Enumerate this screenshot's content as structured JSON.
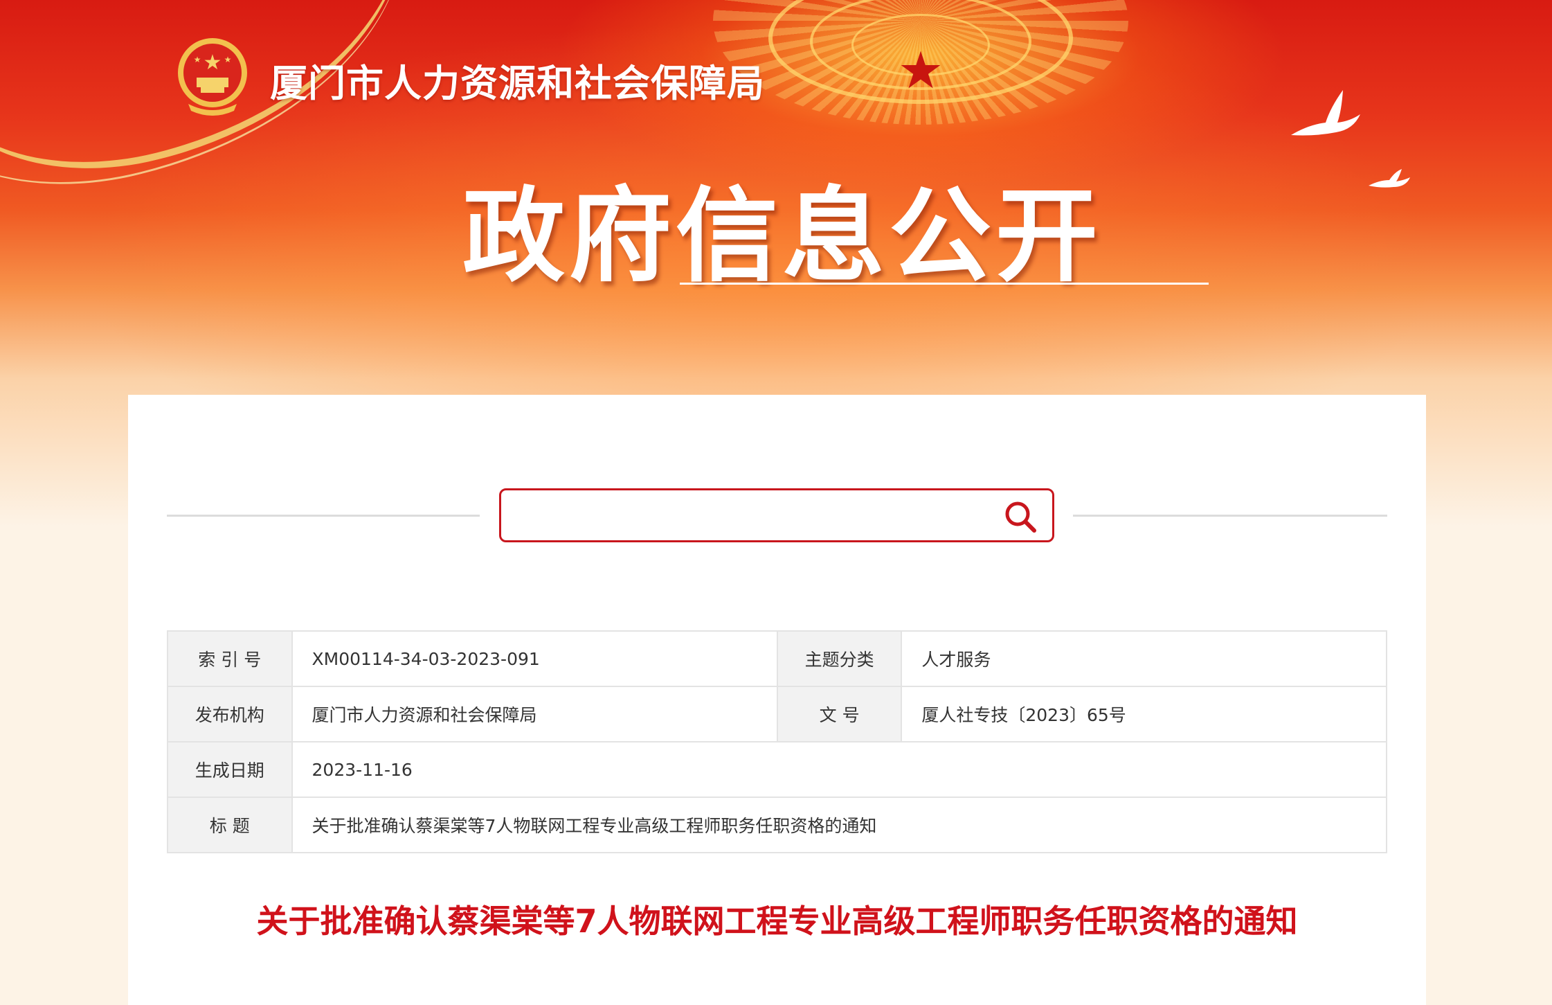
{
  "header": {
    "org_name": "厦门市人力资源和社会保障局",
    "main_title": "政府信息公开"
  },
  "search": {
    "placeholder": "",
    "value": ""
  },
  "meta": {
    "index_label": "索 引 号",
    "index_value": "XM00114-34-03-2023-091",
    "topic_label": "主题分类",
    "topic_value": "人才服务",
    "publisher_label": "发布机构",
    "publisher_value": "厦门市人力资源和社会保障局",
    "docno_label": "文 号",
    "docno_value": "厦人社专技〔2023〕65号",
    "date_label": "生成日期",
    "date_value": "2023-11-16",
    "title_label": "标 题",
    "title_value": "关于批准确认蔡渠棠等7人物联网工程专业高级工程师职务任职资格的通知"
  },
  "document": {
    "title": "关于批准确认蔡渠棠等7人物联网工程专业高级工程师职务任职资格的通知"
  },
  "colors": {
    "brand_red": "#c8161d",
    "title_red": "#d0121b"
  },
  "icons": [
    "national-emblem-icon",
    "star-icon",
    "dove-icon",
    "search-icon"
  ]
}
